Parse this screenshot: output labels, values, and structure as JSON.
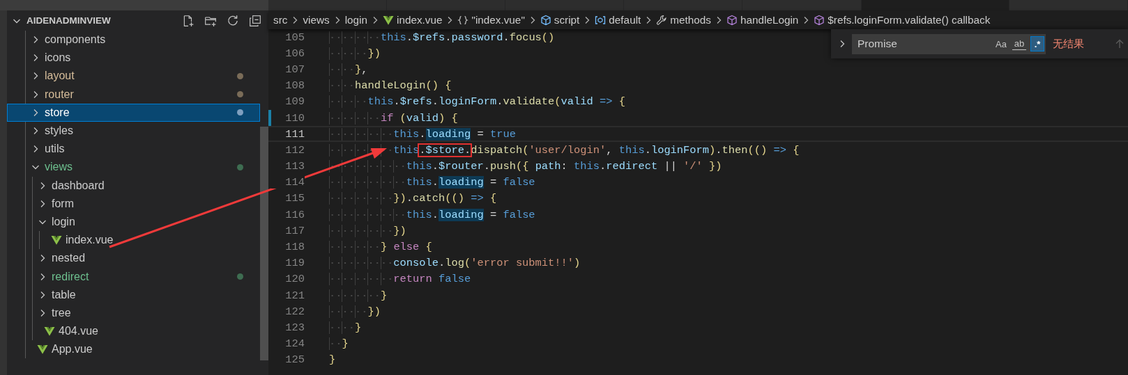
{
  "editor_tabs": [
    {
      "selected": false
    },
    {
      "selected": false
    },
    {
      "selected": false
    },
    {
      "selected": false
    },
    {
      "selected": false
    },
    {
      "selected": true
    },
    {
      "selected": false
    }
  ],
  "explorer": {
    "title": "AIDENADMINVIEW",
    "expanded": true,
    "items": [
      {
        "name": "components",
        "kind": "folder",
        "expanded": false,
        "selected": false
      },
      {
        "name": "icons",
        "kind": "folder",
        "expanded": false,
        "selected": false
      },
      {
        "name": "layout",
        "kind": "folder",
        "expanded": false,
        "selected": false,
        "color": "#7a6c58"
      },
      {
        "name": "router",
        "kind": "folder",
        "expanded": false,
        "selected": false,
        "color": "#7a6c58"
      },
      {
        "name": "store",
        "kind": "folder",
        "expanded": false,
        "selected": true,
        "color": "#7f9fbf"
      },
      {
        "name": "styles",
        "kind": "folder",
        "expanded": false,
        "selected": false
      },
      {
        "name": "utils",
        "kind": "folder",
        "expanded": false,
        "selected": false
      },
      {
        "name": "views",
        "kind": "folder",
        "expanded": true,
        "selected": false,
        "color": "#3e6d51",
        "children": [
          {
            "name": "dashboard",
            "kind": "folder",
            "expanded": false,
            "selected": false
          },
          {
            "name": "form",
            "kind": "folder",
            "expanded": false,
            "selected": false
          },
          {
            "name": "login",
            "kind": "folder",
            "expanded": true,
            "selected": false,
            "children": [
              {
                "name": "index.vue",
                "kind": "vue",
                "selected": false
              }
            ]
          },
          {
            "name": "nested",
            "kind": "folder",
            "expanded": false,
            "selected": false
          },
          {
            "name": "redirect",
            "kind": "folder",
            "expanded": false,
            "selected": false,
            "color": "#3e6d51"
          },
          {
            "name": "table",
            "kind": "folder",
            "expanded": false,
            "selected": false
          },
          {
            "name": "tree",
            "kind": "folder",
            "expanded": false,
            "selected": false
          },
          {
            "name": "404.vue",
            "kind": "vue",
            "selected": false
          }
        ]
      },
      {
        "name": "App.vue",
        "kind": "vue",
        "selected": false
      }
    ]
  },
  "breadcrumb": [
    {
      "text": "src",
      "kind": "folder"
    },
    {
      "text": "views",
      "kind": "folder"
    },
    {
      "text": "login",
      "kind": "folder"
    },
    {
      "text": "index.vue",
      "kind": "vue"
    },
    {
      "text": "\"index.vue\"",
      "kind": "object"
    },
    {
      "text": "script",
      "kind": "module"
    },
    {
      "text": "default",
      "kind": "namespace"
    },
    {
      "text": "methods",
      "kind": "methods"
    },
    {
      "text": "handleLogin",
      "kind": "method"
    },
    {
      "text": "$refs.loginForm.validate() callback",
      "kind": "method"
    }
  ],
  "find_widget": {
    "value": "Promise",
    "options": [
      {
        "text": "Aa",
        "on": false
      },
      {
        "text": "ab",
        "on": false
      },
      {
        "text": ".*",
        "on": true
      }
    ],
    "result": "无结果"
  },
  "code_lines": [
    {
      "number": "105",
      "current": false,
      "changed": false,
      "tokens": [
        {
          "text": "        this",
          "kind": "kw"
        },
        {
          "text": ".",
          "kind": "p"
        },
        {
          "text": "$refs",
          "kind": "v"
        },
        {
          "text": ".",
          "kind": "p"
        },
        {
          "text": "password",
          "kind": "v"
        },
        {
          "text": ".",
          "kind": "p"
        },
        {
          "text": "focus",
          "kind": "fn"
        },
        {
          "text": "()",
          "kind": "br"
        }
      ]
    },
    {
      "number": "106",
      "current": false,
      "changed": false,
      "tokens": [
        {
          "text": "      })",
          "kind": "br"
        }
      ]
    },
    {
      "number": "107",
      "current": false,
      "changed": false,
      "tokens": [
        {
          "text": "    }",
          "kind": "br"
        },
        {
          "text": ",",
          "kind": "p"
        }
      ]
    },
    {
      "number": "108",
      "current": false,
      "changed": false,
      "tokens": [
        {
          "text": "    handleLogin",
          "kind": "fn"
        },
        {
          "text": "() {",
          "kind": "br"
        }
      ]
    },
    {
      "number": "109",
      "current": false,
      "changed": false,
      "tokens": [
        {
          "text": "      this",
          "kind": "kw"
        },
        {
          "text": ".",
          "kind": "p"
        },
        {
          "text": "$refs",
          "kind": "v"
        },
        {
          "text": ".",
          "kind": "p"
        },
        {
          "text": "loginForm",
          "kind": "v"
        },
        {
          "text": ".",
          "kind": "p"
        },
        {
          "text": "validate",
          "kind": "fn"
        },
        {
          "text": "(",
          "kind": "br"
        },
        {
          "text": "valid",
          "kind": "v"
        },
        {
          "text": " => ",
          "kind": "kw"
        },
        {
          "text": "{",
          "kind": "br"
        }
      ]
    },
    {
      "number": "110",
      "current": false,
      "changed": true,
      "tokens": [
        {
          "text": "        if ",
          "kind": "ctl"
        },
        {
          "text": "(",
          "kind": "br"
        },
        {
          "text": "valid",
          "kind": "v"
        },
        {
          "text": ") {",
          "kind": "br"
        }
      ]
    },
    {
      "number": "111",
      "current": true,
      "changed": false,
      "tokens": [
        {
          "text": "          this",
          "kind": "kw"
        },
        {
          "text": ".",
          "kind": "p"
        },
        {
          "text": "loading",
          "kind": "v",
          "hl": true
        },
        {
          "text": " = ",
          "kind": "p"
        },
        {
          "text": "true",
          "kind": "kw"
        }
      ]
    },
    {
      "number": "112",
      "current": false,
      "changed": false,
      "tokens": [
        {
          "text": "          this",
          "kind": "kw"
        },
        {
          "boxed": true,
          "parts": [
            {
              "text": ".",
              "kind": "p"
            },
            {
              "text": "$store",
              "kind": "v"
            },
            {
              "text": ".",
              "kind": "p"
            }
          ]
        },
        {
          "text": "dispatch",
          "kind": "fn"
        },
        {
          "text": "(",
          "kind": "br"
        },
        {
          "text": "'user/login'",
          "kind": "str"
        },
        {
          "text": ", ",
          "kind": "p"
        },
        {
          "text": "this",
          "kind": "kw"
        },
        {
          "text": ".",
          "kind": "p"
        },
        {
          "text": "loginForm",
          "kind": "v"
        },
        {
          "text": ")",
          "kind": "br"
        },
        {
          "text": ".",
          "kind": "p"
        },
        {
          "text": "then",
          "kind": "fn"
        },
        {
          "text": "(()",
          "kind": "br"
        },
        {
          "text": " => ",
          "kind": "kw"
        },
        {
          "text": "{",
          "kind": "br"
        }
      ]
    },
    {
      "number": "113",
      "current": false,
      "changed": false,
      "tokens": [
        {
          "text": "            this",
          "kind": "kw"
        },
        {
          "text": ".",
          "kind": "p"
        },
        {
          "text": "$router",
          "kind": "v"
        },
        {
          "text": ".",
          "kind": "p"
        },
        {
          "text": "push",
          "kind": "fn"
        },
        {
          "text": "({",
          "kind": "br"
        },
        {
          "text": " path",
          "kind": "v"
        },
        {
          "text": ": ",
          "kind": "p"
        },
        {
          "text": "this",
          "kind": "kw"
        },
        {
          "text": ".",
          "kind": "p"
        },
        {
          "text": "redirect",
          "kind": "v"
        },
        {
          "text": " || ",
          "kind": "p"
        },
        {
          "text": "'/'",
          "kind": "str"
        },
        {
          "text": " })",
          "kind": "br"
        }
      ]
    },
    {
      "number": "114",
      "current": false,
      "changed": false,
      "tokens": [
        {
          "text": "            this",
          "kind": "kw"
        },
        {
          "text": ".",
          "kind": "p"
        },
        {
          "text": "loading",
          "kind": "v",
          "hl": true
        },
        {
          "text": " = ",
          "kind": "p"
        },
        {
          "text": "false",
          "kind": "kw"
        }
      ]
    },
    {
      "number": "115",
      "current": false,
      "changed": false,
      "tokens": [
        {
          "text": "          })",
          "kind": "br"
        },
        {
          "text": ".",
          "kind": "p"
        },
        {
          "text": "catch",
          "kind": "fn"
        },
        {
          "text": "(()",
          "kind": "br"
        },
        {
          "text": " => ",
          "kind": "kw"
        },
        {
          "text": "{",
          "kind": "br"
        }
      ]
    },
    {
      "number": "116",
      "current": false,
      "changed": false,
      "tokens": [
        {
          "text": "            this",
          "kind": "kw"
        },
        {
          "text": ".",
          "kind": "p"
        },
        {
          "text": "loading",
          "kind": "v",
          "hl": true
        },
        {
          "text": " = ",
          "kind": "p"
        },
        {
          "text": "false",
          "kind": "kw"
        }
      ]
    },
    {
      "number": "117",
      "current": false,
      "changed": false,
      "tokens": [
        {
          "text": "          })",
          "kind": "br"
        }
      ]
    },
    {
      "number": "118",
      "current": false,
      "changed": false,
      "tokens": [
        {
          "text": "        }",
          "kind": "br"
        },
        {
          "text": " else ",
          "kind": "ctl"
        },
        {
          "text": "{",
          "kind": "br"
        }
      ]
    },
    {
      "number": "119",
      "current": false,
      "changed": false,
      "tokens": [
        {
          "text": "          console",
          "kind": "v"
        },
        {
          "text": ".",
          "kind": "p"
        },
        {
          "text": "log",
          "kind": "fn"
        },
        {
          "text": "(",
          "kind": "br"
        },
        {
          "text": "'error submit!!'",
          "kind": "str"
        },
        {
          "text": ")",
          "kind": "br"
        }
      ]
    },
    {
      "number": "120",
      "current": false,
      "changed": false,
      "tokens": [
        {
          "text": "          return ",
          "kind": "ctl"
        },
        {
          "text": "false",
          "kind": "kw"
        }
      ]
    },
    {
      "number": "121",
      "current": false,
      "changed": false,
      "tokens": [
        {
          "text": "        }",
          "kind": "br"
        }
      ]
    },
    {
      "number": "122",
      "current": false,
      "changed": false,
      "tokens": [
        {
          "text": "      })",
          "kind": "br"
        }
      ]
    },
    {
      "number": "123",
      "current": false,
      "changed": false,
      "tokens": [
        {
          "text": "    }",
          "kind": "br"
        }
      ]
    },
    {
      "number": "124",
      "current": false,
      "changed": false,
      "tokens": [
        {
          "text": "  }",
          "kind": "br"
        }
      ]
    },
    {
      "number": "125",
      "current": false,
      "changed": false,
      "tokens": [
        {
          "text": "}",
          "kind": "br"
        }
      ]
    }
  ],
  "annotation_arrow": true
}
